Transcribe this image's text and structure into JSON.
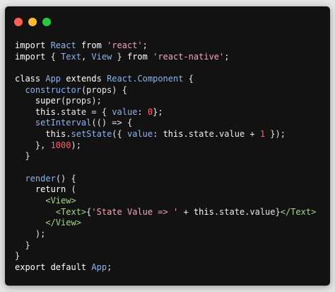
{
  "window": {
    "buttons": [
      {
        "name": "close",
        "color": "#ff5f57"
      },
      {
        "name": "minimize",
        "color": "#febc2e"
      },
      {
        "name": "zoom",
        "color": "#28c840"
      }
    ]
  },
  "code": {
    "lines": [
      [
        {
          "t": "import ",
          "c": "kw"
        },
        {
          "t": "React",
          "c": "ident"
        },
        {
          "t": " from ",
          "c": "kw"
        },
        {
          "t": "'react'",
          "c": "str"
        },
        {
          "t": ";",
          "c": "punc"
        }
      ],
      [
        {
          "t": "import ",
          "c": "kw"
        },
        {
          "t": "{ ",
          "c": "punc"
        },
        {
          "t": "Text",
          "c": "ident"
        },
        {
          "t": ", ",
          "c": "punc"
        },
        {
          "t": "View",
          "c": "ident"
        },
        {
          "t": " } ",
          "c": "punc"
        },
        {
          "t": "from ",
          "c": "kw"
        },
        {
          "t": "'react-native'",
          "c": "str"
        },
        {
          "t": ";",
          "c": "punc"
        }
      ],
      [],
      [
        {
          "t": "class ",
          "c": "kw"
        },
        {
          "t": "App",
          "c": "ident"
        },
        {
          "t": " extends ",
          "c": "kw"
        },
        {
          "t": "React.Component",
          "c": "ident"
        },
        {
          "t": " {",
          "c": "punc"
        }
      ],
      [
        {
          "t": "  ",
          "c": "plain"
        },
        {
          "t": "constructor",
          "c": "ident"
        },
        {
          "t": "(props) {",
          "c": "punc"
        }
      ],
      [
        {
          "t": "    ",
          "c": "plain"
        },
        {
          "t": "super",
          "c": "kw"
        },
        {
          "t": "(props);",
          "c": "punc"
        }
      ],
      [
        {
          "t": "    ",
          "c": "plain"
        },
        {
          "t": "this",
          "c": "kw"
        },
        {
          "t": ".state = { ",
          "c": "punc"
        },
        {
          "t": "value",
          "c": "ident"
        },
        {
          "t": ": ",
          "c": "punc"
        },
        {
          "t": "0",
          "c": "num"
        },
        {
          "t": "};",
          "c": "punc"
        }
      ],
      [
        {
          "t": "    ",
          "c": "plain"
        },
        {
          "t": "setInterval",
          "c": "ident"
        },
        {
          "t": "(() => {",
          "c": "punc"
        }
      ],
      [
        {
          "t": "      ",
          "c": "plain"
        },
        {
          "t": "this",
          "c": "kw"
        },
        {
          "t": ".",
          "c": "punc"
        },
        {
          "t": "setState",
          "c": "ident"
        },
        {
          "t": "({ ",
          "c": "punc"
        },
        {
          "t": "value",
          "c": "ident"
        },
        {
          "t": ": ",
          "c": "punc"
        },
        {
          "t": "this",
          "c": "kw"
        },
        {
          "t": ".state.value + ",
          "c": "punc"
        },
        {
          "t": "1",
          "c": "num"
        },
        {
          "t": " });",
          "c": "punc"
        }
      ],
      [
        {
          "t": "    }, ",
          "c": "punc"
        },
        {
          "t": "1000",
          "c": "num"
        },
        {
          "t": ");",
          "c": "punc"
        }
      ],
      [
        {
          "t": "  }",
          "c": "punc"
        }
      ],
      [],
      [
        {
          "t": "  ",
          "c": "plain"
        },
        {
          "t": "render",
          "c": "ident"
        },
        {
          "t": "() {",
          "c": "punc"
        }
      ],
      [
        {
          "t": "    ",
          "c": "plain"
        },
        {
          "t": "return",
          "c": "kw"
        },
        {
          "t": " (",
          "c": "punc"
        }
      ],
      [
        {
          "t": "      ",
          "c": "plain"
        },
        {
          "t": "<View>",
          "c": "tag"
        }
      ],
      [
        {
          "t": "        ",
          "c": "plain"
        },
        {
          "t": "<Text>",
          "c": "tag"
        },
        {
          "t": "{",
          "c": "punc"
        },
        {
          "t": "'State Value => '",
          "c": "str"
        },
        {
          "t": " + ",
          "c": "punc"
        },
        {
          "t": "this",
          "c": "kw"
        },
        {
          "t": ".state.value}",
          "c": "punc"
        },
        {
          "t": "</Text>",
          "c": "tag"
        }
      ],
      [
        {
          "t": "      ",
          "c": "plain"
        },
        {
          "t": "</View>",
          "c": "tag"
        }
      ],
      [
        {
          "t": "    );",
          "c": "punc"
        }
      ],
      [
        {
          "t": "  }",
          "c": "punc"
        }
      ],
      [
        {
          "t": "}",
          "c": "punc"
        }
      ],
      [
        {
          "t": "export ",
          "c": "kw"
        },
        {
          "t": "default ",
          "c": "kw"
        },
        {
          "t": "App",
          "c": "ident"
        },
        {
          "t": ";",
          "c": "punc"
        }
      ]
    ]
  }
}
